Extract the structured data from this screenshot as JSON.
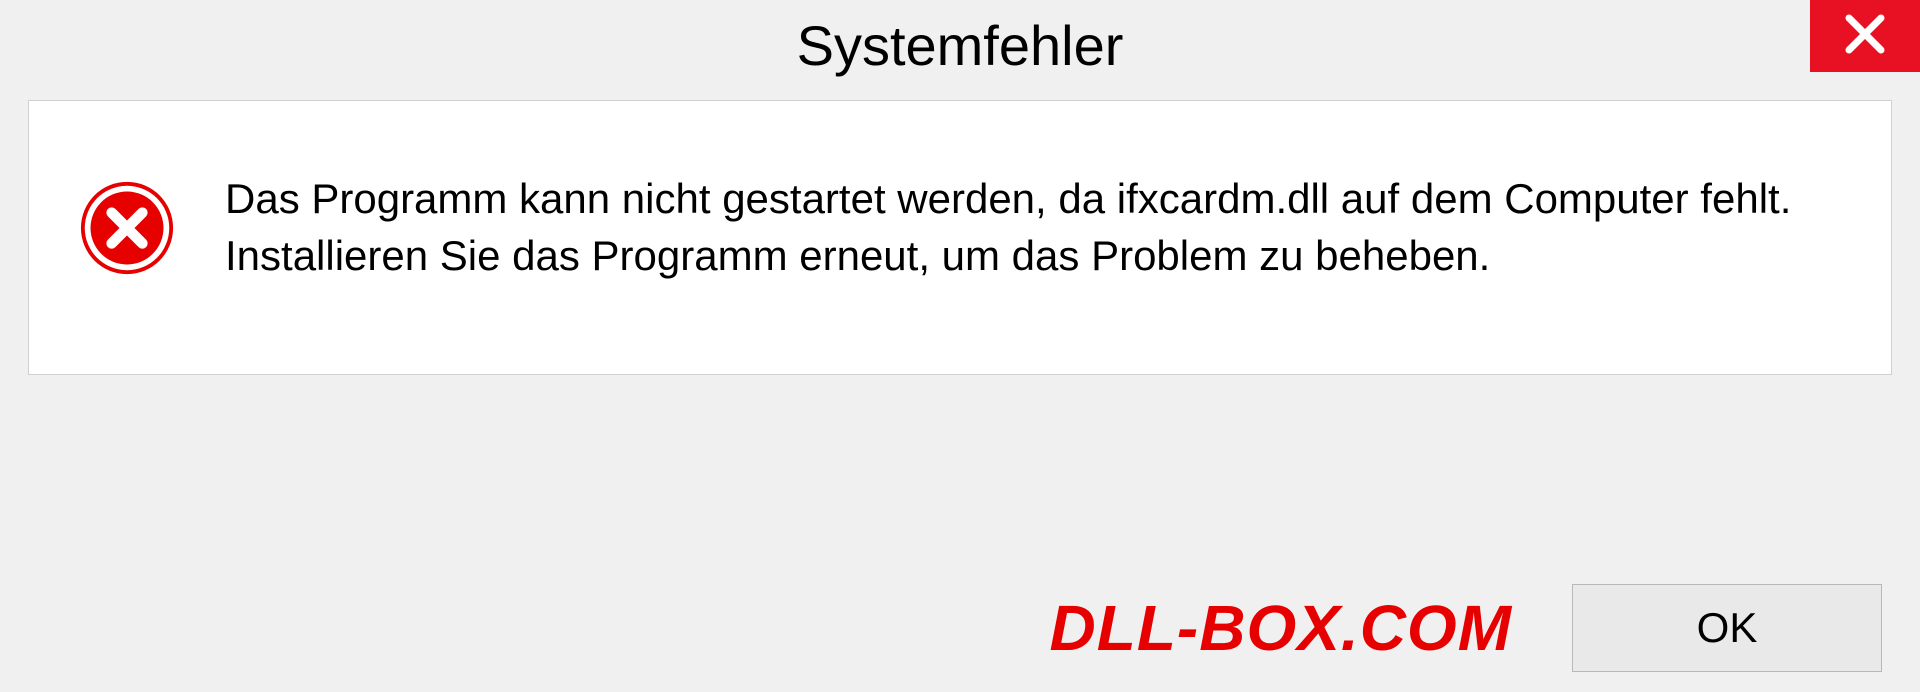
{
  "title": "Systemfehler",
  "message": "Das Programm kann nicht gestartet werden, da ifxcardm.dll auf dem Computer fehlt. Installieren Sie das Programm erneut, um das Problem zu beheben.",
  "watermark": "DLL-BOX.COM",
  "ok_label": "OK",
  "colors": {
    "close_bg": "#e81123",
    "error_icon": "#e60000",
    "watermark": "#e60000"
  }
}
